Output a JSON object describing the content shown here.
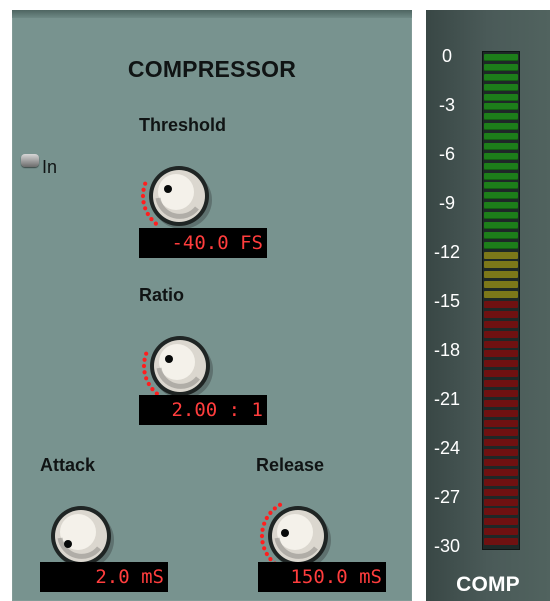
{
  "compressor": {
    "title": "COMPRESSOR",
    "in_toggle_label": "In",
    "threshold": {
      "label": "Threshold",
      "display": "-40.0 FS",
      "arc_fraction": 0.23
    },
    "ratio": {
      "label": "Ratio",
      "display": "2.00 : 1",
      "arc_fraction": 0.23
    },
    "attack": {
      "label": "Attack",
      "display": "2.0 mS",
      "arc_fraction": 0.0
    },
    "release": {
      "label": "Release",
      "display": "150.0 mS",
      "arc_fraction": 0.38
    }
  },
  "meter": {
    "title": "COMP",
    "scale_labels": [
      "0",
      "-3",
      "-6",
      "-9",
      "-12",
      "-15",
      "-18",
      "-21",
      "-24",
      "-27",
      "-30"
    ]
  },
  "colors": {
    "panel": "#78938f",
    "panel_dark": "#4e6561",
    "display_bg": "#000000",
    "display_text": "#ff3d3d",
    "arc_red": "#ff1e1e",
    "meter_green": "#1d7e1a",
    "meter_yellow": "#7c7819",
    "meter_red": "#6f1111",
    "label_text": "#101414",
    "meter_text": "#ffffff"
  },
  "icons": {
    "toggle": "toggle-icon",
    "knob": "knob-icon"
  }
}
